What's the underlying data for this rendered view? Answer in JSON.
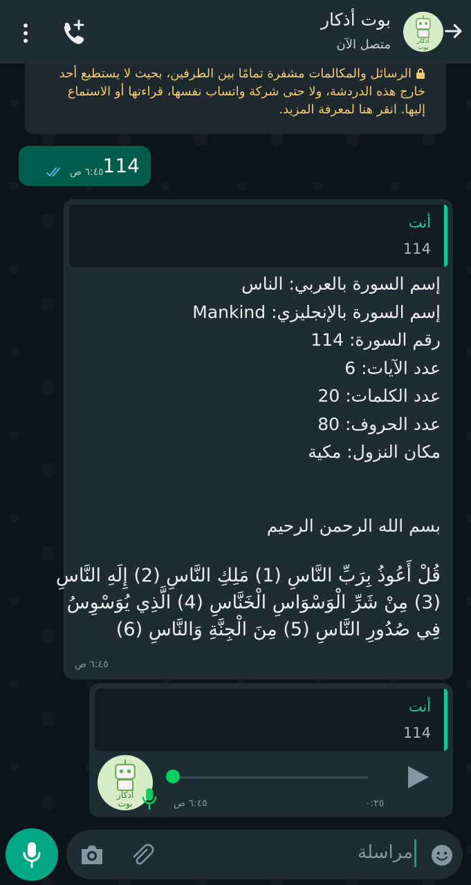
{
  "header": {
    "title": "بوت أذكار",
    "status": "متصل الآن",
    "avatar_text": "أذكار بوت"
  },
  "encryption_notice": "الرسائل والمكالمات مشفرة تمامًا بين الطرفين، بحيث لا يستطيع أحد خارج هذه الدردشة، ولا حتى شركة واتساب نفسها، قراءتها أو الاستماع إليها. انقر هنا لمعرفة المزيد.",
  "messages": {
    "outgoing": {
      "text": "114",
      "time": "٦:٤٥ ص"
    },
    "surah_reply": {
      "quote_author": "أنت",
      "quote_text": "114",
      "info_lines": [
        "إسم السورة بالعربي: الناس",
        "إسم السورة بالإنجليزي: Mankind",
        "رقم السورة: 114",
        "عدد الآيات: 6",
        "عدد الكلمات: 20",
        "عدد الحروف: 80",
        "مكان النزول: مكية"
      ],
      "basmala": "بسم الله الرحمن الرحيم",
      "verses": [
        "قُلْ أَعُوذُ بِرَبِّ النَّاسِ (1) مَلِكِ النَّاسِ (2) إِلَهِ النَّاسِ",
        "(3) مِنْ شَرِّ الْوَسْوَاسِ الْخَنَّاسِ (4) الَّذِي يُوَسْوِسُ",
        "فِي صُدُورِ النَّاسِ (5) مِنَ الْجِنَّةِ وَالنَّاسِ (6)"
      ],
      "time": "٦:٤٥ ص"
    },
    "audio_reply": {
      "quote_author": "أنت",
      "quote_text": "114",
      "duration": "٠:٢٥",
      "time": "٦:٤٥ ص",
      "progress": 0
    }
  },
  "composer": {
    "placeholder": "مراسلة"
  },
  "colors": {
    "accent": "#00a884",
    "outgoing_bubble": "#005c4b",
    "incoming_bubble": "#1f2c34",
    "quote_bar": "#06cf9c",
    "encryption_text": "#f7cd6b"
  },
  "icons": [
    "back-arrow-icon",
    "add-call-icon",
    "more-vert-icon",
    "lock-icon",
    "double-check-icon",
    "play-icon",
    "mic-icon",
    "emoji-icon",
    "attach-icon",
    "camera-icon"
  ]
}
